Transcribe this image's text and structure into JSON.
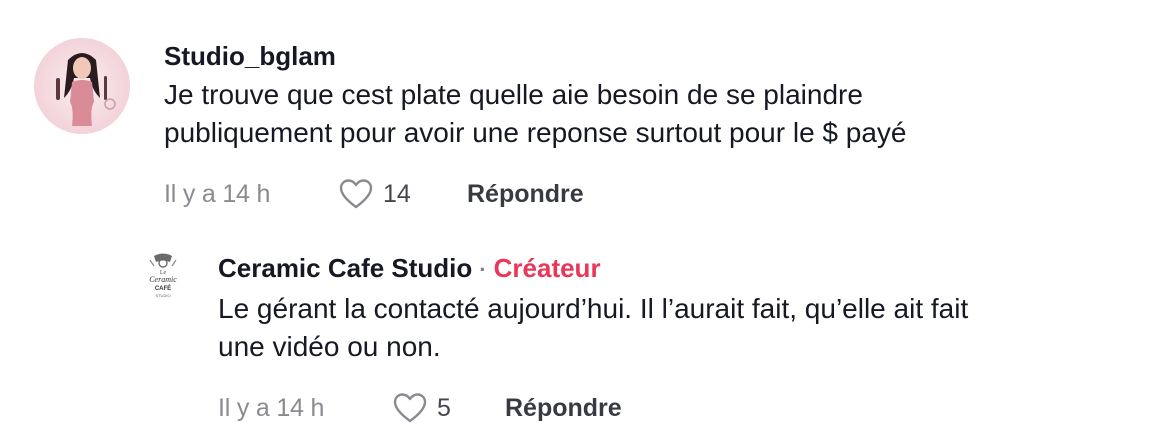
{
  "comments": [
    {
      "username": "Studio_bglam",
      "text_line1": "Je trouve que cest plate quelle aie besoin de se plaindre",
      "text_line2": "publiquement pour avoir une reponse surtout pour le $ payé",
      "time": "Il y a 14 h",
      "likes": "14",
      "reply_label": "Répondre"
    }
  ],
  "reply": {
    "username": "Ceramic Cafe Studio",
    "separator": "·",
    "badge": "Créateur",
    "text_line1": "Le gérant la contacté aujourd’hui. Il l’aurait fait, qu’elle ait fait",
    "text_line2": "une vidéo ou non.",
    "time": "Il y a 14 h",
    "likes": "5",
    "reply_label": "Répondre",
    "logo_lines": [
      "Le",
      "Ceramic",
      "CAFÉ",
      "STUDIO"
    ]
  },
  "colors": {
    "creator_badge": "#e8375a",
    "text": "#161823",
    "meta": "#8a8b91"
  },
  "icons": {
    "like": "heart-outline-icon"
  }
}
